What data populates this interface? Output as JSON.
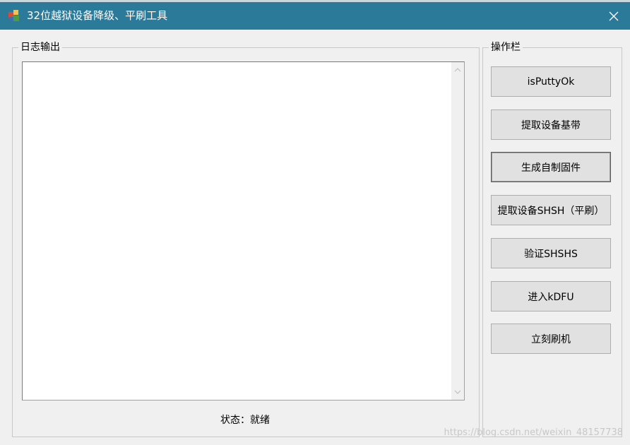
{
  "window": {
    "title": "32位越狱设备降级、平刷工具"
  },
  "log_group": {
    "legend": "日志输出",
    "log_text": ""
  },
  "status": {
    "text": "状态：就绪"
  },
  "ops_group": {
    "legend": "操作栏",
    "buttons": [
      {
        "label": "isPuttyOk"
      },
      {
        "label": "提取设备基带"
      },
      {
        "label": "生成自制固件"
      },
      {
        "label": "提取设备SHSH（平刷）"
      },
      {
        "label": "验证SHSHS"
      },
      {
        "label": "进入kDFU"
      },
      {
        "label": "立刻刷机"
      }
    ]
  },
  "watermark": "https://blog.csdn.net/weixin_48157738",
  "icons": {
    "app": "app-icon",
    "close": "close-icon",
    "scroll_up": "chevron-up-icon",
    "scroll_down": "chevron-down-icon"
  },
  "colors": {
    "titlebar": "#2b7a99",
    "window_bg": "#f0f0f0",
    "button_bg": "#e1e1e1"
  }
}
